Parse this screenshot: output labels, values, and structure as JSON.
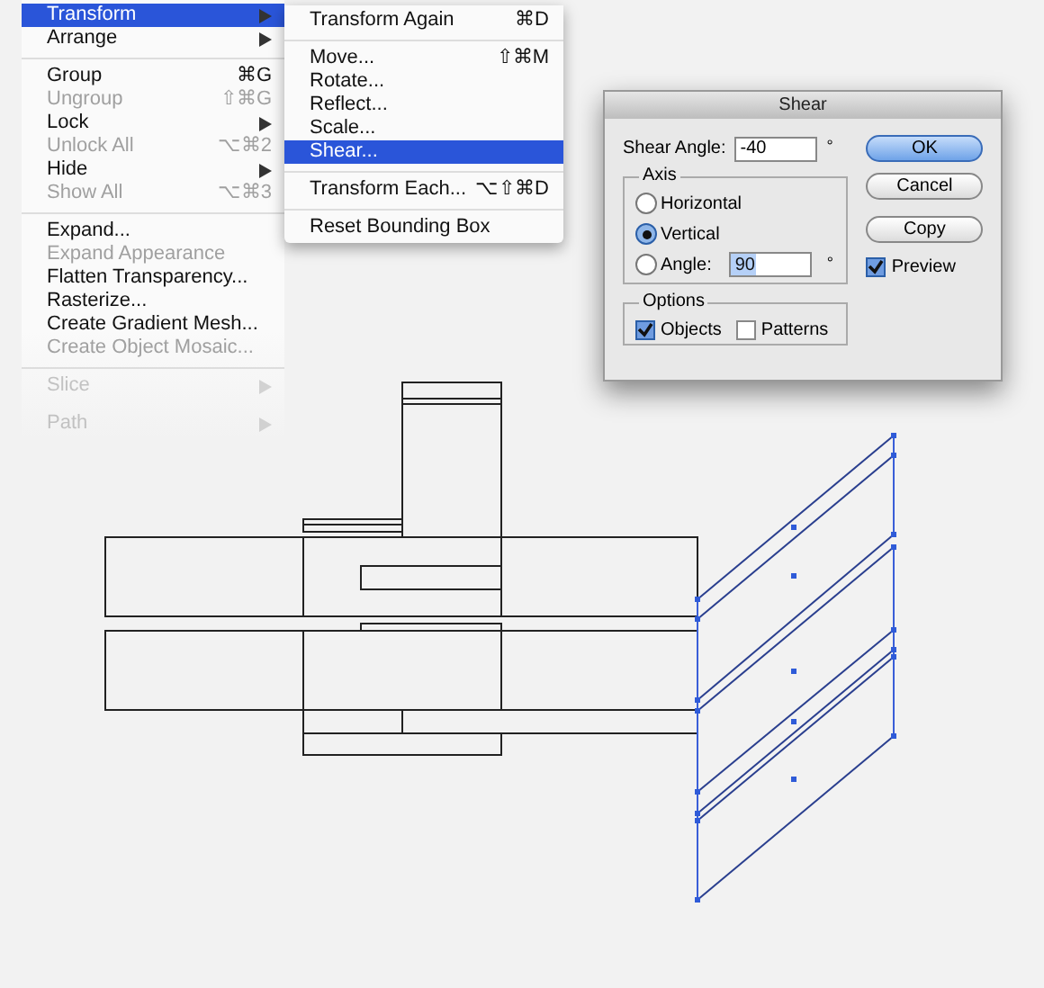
{
  "menu": {
    "items": [
      {
        "kind": "item",
        "label": "Transform",
        "submenu": true,
        "disabled": false,
        "selected": true
      },
      {
        "kind": "item",
        "label": "Arrange",
        "submenu": true,
        "disabled": false,
        "selected": false
      },
      {
        "kind": "separator"
      },
      {
        "kind": "item",
        "label": "Group",
        "shortcut": "⌘G",
        "disabled": false,
        "selected": false
      },
      {
        "kind": "item",
        "label": "Ungroup",
        "shortcut": "⇧⌘G",
        "disabled": true,
        "selected": false
      },
      {
        "kind": "item",
        "label": "Lock",
        "submenu": true,
        "disabled": false,
        "selected": false
      },
      {
        "kind": "item",
        "label": "Unlock All",
        "shortcut": "⌥⌘2",
        "disabled": true,
        "selected": false
      },
      {
        "kind": "item",
        "label": "Hide",
        "submenu": true,
        "disabled": false,
        "selected": false
      },
      {
        "kind": "item",
        "label": "Show All",
        "shortcut": "⌥⌘3",
        "disabled": true,
        "selected": false
      },
      {
        "kind": "separator"
      },
      {
        "kind": "item",
        "label": "Expand...",
        "disabled": false,
        "selected": false
      },
      {
        "kind": "item",
        "label": "Expand Appearance",
        "disabled": true,
        "selected": false
      },
      {
        "kind": "item",
        "label": "Flatten Transparency...",
        "disabled": false,
        "selected": false
      },
      {
        "kind": "item",
        "label": "Rasterize...",
        "disabled": false,
        "selected": false
      },
      {
        "kind": "item",
        "label": "Create Gradient Mesh...",
        "disabled": false,
        "selected": false
      },
      {
        "kind": "item",
        "label": "Create Object Mosaic...",
        "disabled": true,
        "selected": false
      },
      {
        "kind": "separator"
      },
      {
        "kind": "item",
        "label": "Slice",
        "submenu": true,
        "disabled": true,
        "selected": false
      },
      {
        "kind": "item",
        "label": "Path",
        "submenu": true,
        "disabled": true,
        "selected": false
      }
    ]
  },
  "submenu": {
    "items": [
      {
        "kind": "item",
        "label": "Transform Again",
        "shortcut": "⌘D",
        "selected": false
      },
      {
        "kind": "separator"
      },
      {
        "kind": "item",
        "label": "Move...",
        "shortcut": "⇧⌘M",
        "selected": false
      },
      {
        "kind": "item",
        "label": "Rotate...",
        "selected": false
      },
      {
        "kind": "item",
        "label": "Reflect...",
        "selected": false
      },
      {
        "kind": "item",
        "label": "Scale...",
        "selected": false
      },
      {
        "kind": "item",
        "label": "Shear...",
        "selected": true
      },
      {
        "kind": "separator"
      },
      {
        "kind": "item",
        "label": "Transform Each...",
        "shortcut": "⌥⇧⌘D",
        "selected": false
      },
      {
        "kind": "separator"
      },
      {
        "kind": "item",
        "label": "Reset Bounding Box",
        "selected": false
      }
    ]
  },
  "dialog": {
    "title": "Shear",
    "shear_angle": {
      "label": "Shear Angle:",
      "value": "-40",
      "unit": "°"
    },
    "axis": {
      "legend": "Axis",
      "options": [
        {
          "kind": "radio",
          "label": "Horizontal",
          "selected": false
        },
        {
          "kind": "radio",
          "label": "Vertical",
          "selected": true
        },
        {
          "kind": "radio_field",
          "label": "Angle:",
          "selected": false,
          "value": "90",
          "unit": "°"
        }
      ]
    },
    "options": {
      "legend": "Options",
      "checkboxes": [
        {
          "label": "Objects",
          "checked": true
        },
        {
          "label": "Patterns",
          "checked": false
        }
      ]
    },
    "buttons": [
      {
        "label": "OK",
        "default": true
      },
      {
        "label": "Cancel",
        "default": false
      },
      {
        "label": "Copy",
        "default": false
      }
    ],
    "preview": {
      "label": "Preview",
      "checked": true
    }
  }
}
